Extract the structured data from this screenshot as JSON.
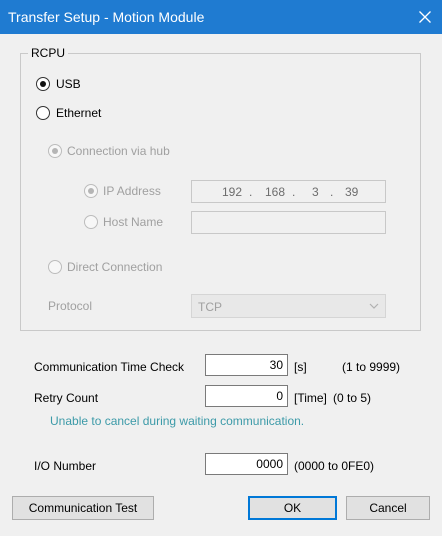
{
  "window": {
    "title": "Transfer Setup - Motion Module"
  },
  "rcpu": {
    "group_label": "RCPU",
    "usb": {
      "label": "USB",
      "selected": true
    },
    "ethernet": {
      "label": "Ethernet",
      "selected": false
    },
    "connection_via_hub": {
      "label": "Connection via hub",
      "selected": true,
      "enabled": false
    },
    "ip_address": {
      "label": "IP Address",
      "selected": true,
      "enabled": false,
      "octets": [
        "192",
        "168",
        "3",
        "39"
      ],
      "separators": [
        ".",
        ".",
        "."
      ]
    },
    "host_name": {
      "label": "Host Name",
      "selected": false,
      "enabled": false,
      "value": ""
    },
    "direct_connection": {
      "label": "Direct Connection",
      "selected": false,
      "enabled": false
    },
    "protocol": {
      "label": "Protocol",
      "value": "TCP",
      "enabled": false
    }
  },
  "settings": {
    "comm_time_check": {
      "label": "Communication Time Check",
      "value": "30",
      "unit": "[s]",
      "range": "(1 to 9999)"
    },
    "retry_count": {
      "label": "Retry Count",
      "value": "0",
      "unit": "[Time]",
      "range": "(0 to 5)"
    },
    "note": "Unable to cancel during waiting communication.",
    "io_number": {
      "label": "I/O Number",
      "value": "0000",
      "range": "(0000 to 0FE0)"
    }
  },
  "buttons": {
    "comm_test": "Communication Test",
    "ok": "OK",
    "cancel": "Cancel"
  },
  "colors": {
    "titlebar": "#1f7bd1",
    "note": "#3c9aa8",
    "default_border": "#0078d7"
  },
  "icons": {
    "close": "close-icon",
    "dropdown": "chevron-down-icon"
  }
}
